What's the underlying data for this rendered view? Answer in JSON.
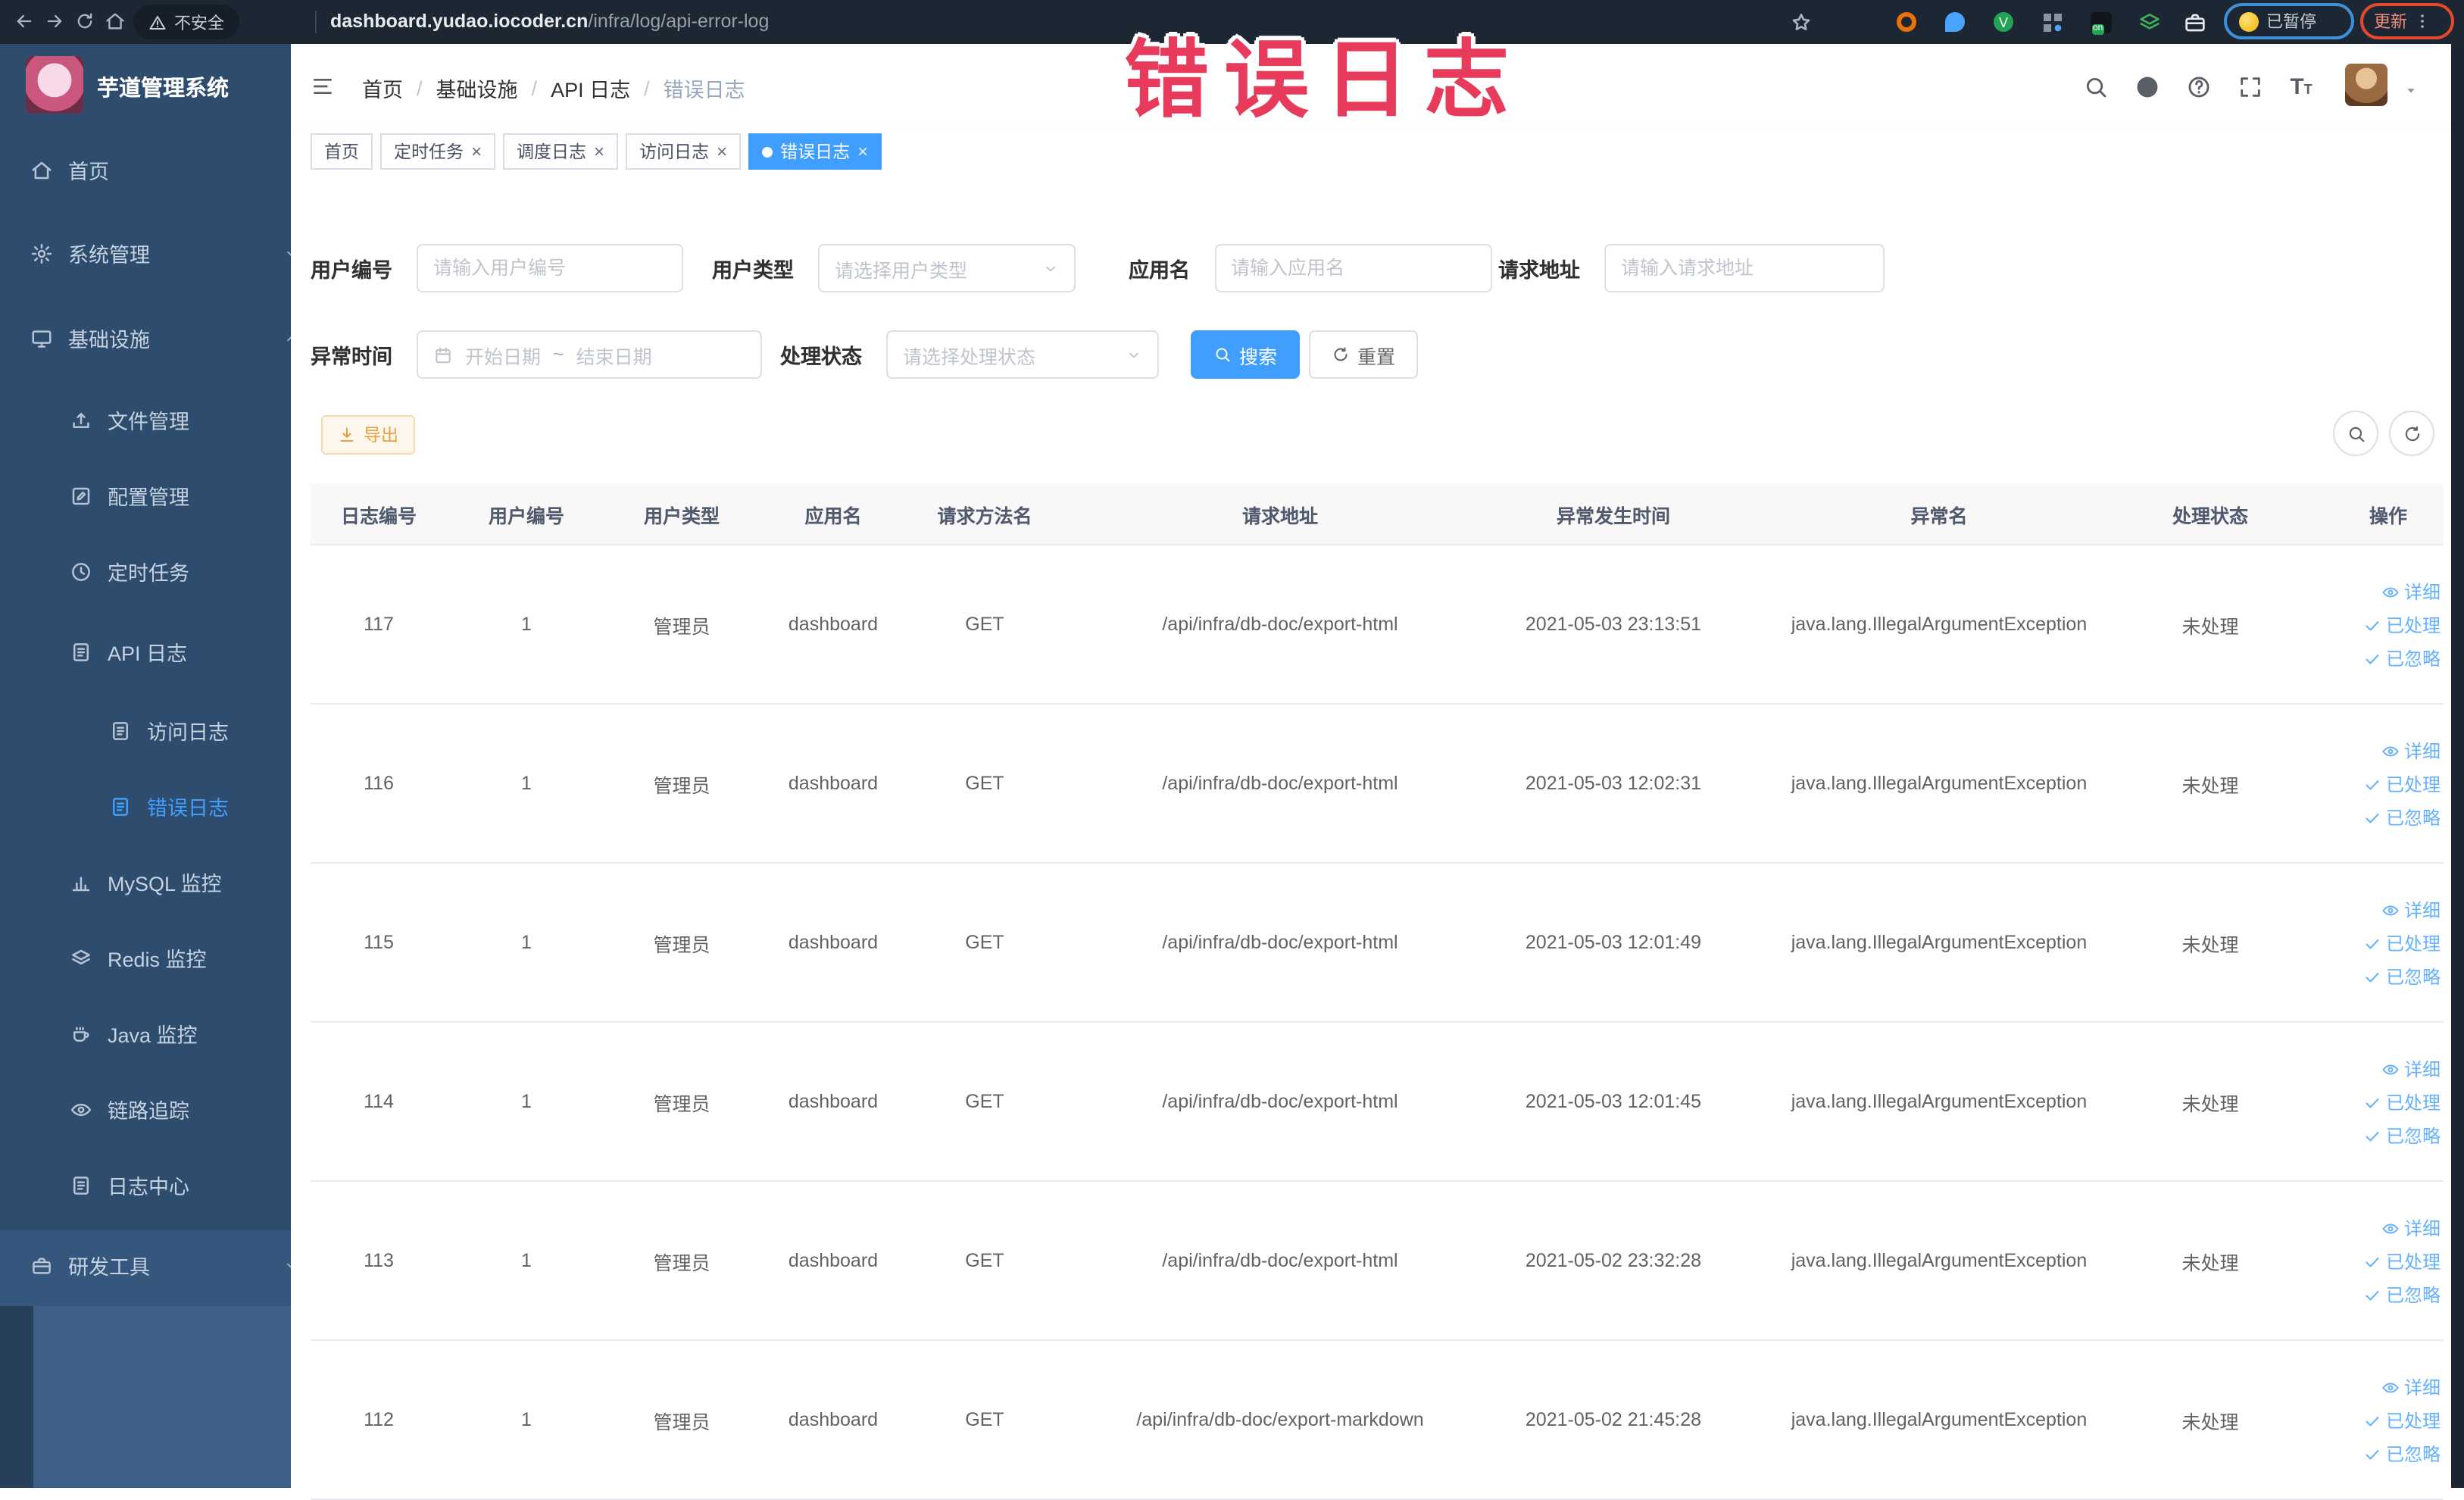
{
  "colors": {
    "primary": "#409eff",
    "warning": "#e6a23c",
    "annotation_red": "#e83a5a",
    "sidebar_bg": "#2e4d6e",
    "browser_bar": "#1d2733"
  },
  "annotation": {
    "text": "错误日志"
  },
  "browser": {
    "security_label": "不安全",
    "url_host": "dashboard.yudao.iocoder.cn",
    "url_path": "/infra/log/api-error-log",
    "paused_label": "已暂停",
    "update_label": "更新"
  },
  "sidebar": {
    "title": "芋道管理系统",
    "items": [
      {
        "label": "首页",
        "icon": "home",
        "level": 1
      },
      {
        "label": "系统管理",
        "icon": "gear",
        "level": 1,
        "chevron": "down"
      },
      {
        "label": "基础设施",
        "icon": "monitor",
        "level": 1,
        "chevron": "up"
      },
      {
        "label": "文件管理",
        "icon": "upload",
        "level": 2
      },
      {
        "label": "配置管理",
        "icon": "edit",
        "level": 2
      },
      {
        "label": "定时任务",
        "icon": "clock",
        "level": 2
      },
      {
        "label": "API 日志",
        "icon": "log",
        "level": 2,
        "chevron": "up"
      },
      {
        "label": "访问日志",
        "icon": "log",
        "level": 3
      },
      {
        "label": "错误日志",
        "icon": "log",
        "level": 3,
        "active": true
      },
      {
        "label": "MySQL 监控",
        "icon": "chart",
        "level": 2
      },
      {
        "label": "Redis 监控",
        "icon": "layers",
        "level": 2
      },
      {
        "label": "Java 监控",
        "icon": "coffee",
        "level": 2
      },
      {
        "label": "链路追踪",
        "icon": "eye",
        "level": 2
      },
      {
        "label": "日志中心",
        "icon": "log",
        "level": 2
      },
      {
        "label": "研发工具",
        "icon": "briefcase",
        "level": 1,
        "chevron": "down",
        "footer": true
      }
    ]
  },
  "header": {
    "breadcrumb": [
      "首页",
      "基础设施",
      "API 日志",
      "错误日志"
    ]
  },
  "tags": [
    {
      "label": "首页"
    },
    {
      "label": "定时任务",
      "closable": true
    },
    {
      "label": "调度日志",
      "closable": true
    },
    {
      "label": "访问日志",
      "closable": true
    },
    {
      "label": "错误日志",
      "closable": true,
      "active": true
    }
  ],
  "filters": {
    "user_id": {
      "label": "用户编号",
      "placeholder": "请输入用户编号"
    },
    "user_type": {
      "label": "用户类型",
      "placeholder": "请选择用户类型"
    },
    "app_name": {
      "label": "应用名",
      "placeholder": "请输入应用名"
    },
    "request_url": {
      "label": "请求地址",
      "placeholder": "请输入请求地址"
    },
    "exception_time": {
      "label": "异常时间",
      "start_placeholder": "开始日期",
      "separator": "~",
      "end_placeholder": "结束日期"
    },
    "process_status": {
      "label": "处理状态",
      "placeholder": "请选择处理状态"
    },
    "search_label": "搜索",
    "reset_label": "重置"
  },
  "toolbar": {
    "export_label": "导出"
  },
  "table": {
    "headers": [
      "日志编号",
      "用户编号",
      "用户类型",
      "应用名",
      "请求方法名",
      "请求地址",
      "异常发生时间",
      "异常名",
      "处理状态",
      "操作"
    ],
    "row_actions": [
      {
        "label": "详细",
        "icon": "eye"
      },
      {
        "label": "已处理",
        "icon": "check"
      },
      {
        "label": "已忽略",
        "icon": "check"
      }
    ],
    "rows": [
      {
        "id": "117",
        "user_id": "1",
        "user_type": "管理员",
        "app": "dashboard",
        "method": "GET",
        "url": "/api/infra/db-doc/export-html",
        "time": "2021-05-03 23:13:51",
        "exception": "java.lang.IllegalArgumentException",
        "status": "未处理"
      },
      {
        "id": "116",
        "user_id": "1",
        "user_type": "管理员",
        "app": "dashboard",
        "method": "GET",
        "url": "/api/infra/db-doc/export-html",
        "time": "2021-05-03 12:02:31",
        "exception": "java.lang.IllegalArgumentException",
        "status": "未处理"
      },
      {
        "id": "115",
        "user_id": "1",
        "user_type": "管理员",
        "app": "dashboard",
        "method": "GET",
        "url": "/api/infra/db-doc/export-html",
        "time": "2021-05-03 12:01:49",
        "exception": "java.lang.IllegalArgumentException",
        "status": "未处理"
      },
      {
        "id": "114",
        "user_id": "1",
        "user_type": "管理员",
        "app": "dashboard",
        "method": "GET",
        "url": "/api/infra/db-doc/export-html",
        "time": "2021-05-03 12:01:45",
        "exception": "java.lang.IllegalArgumentException",
        "status": "未处理"
      },
      {
        "id": "113",
        "user_id": "1",
        "user_type": "管理员",
        "app": "dashboard",
        "method": "GET",
        "url": "/api/infra/db-doc/export-html",
        "time": "2021-05-02 23:32:28",
        "exception": "java.lang.IllegalArgumentException",
        "status": "未处理"
      },
      {
        "id": "112",
        "user_id": "1",
        "user_type": "管理员",
        "app": "dashboard",
        "method": "GET",
        "url": "/api/infra/db-doc/export-markdown",
        "time": "2021-05-02 21:45:28",
        "exception": "java.lang.IllegalArgumentException",
        "status": "未处理"
      }
    ]
  }
}
